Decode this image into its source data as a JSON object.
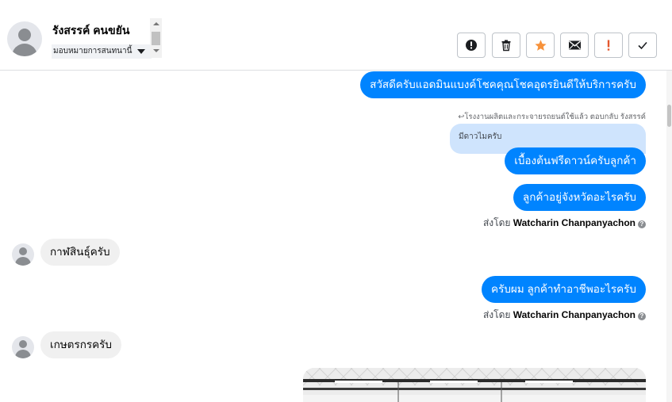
{
  "header": {
    "customer_name": "รังสรรค์ คนขยัน",
    "assign_label": "มอบหมายการสนทนานี้",
    "actions": [
      {
        "name": "report-button",
        "icon": "alert-circle-icon"
      },
      {
        "name": "delete-button",
        "icon": "trash-icon"
      },
      {
        "name": "star-button",
        "icon": "star-icon"
      },
      {
        "name": "mark-unread-button",
        "icon": "envelope-icon"
      },
      {
        "name": "follow-up-button",
        "icon": "exclamation-icon"
      },
      {
        "name": "mark-done-button",
        "icon": "check-icon"
      }
    ]
  },
  "chat": {
    "msg_greeting": "สวัสดีครับแอดมินแบงค์โชคคุณโชคอุดรยินดีให้บริการครับ",
    "reply_note": "โรงงานผลิตและกระจายรถยนต์ใช้แล้ว ตอบกลับ รังสรรค์",
    "quote_text": "มีดาวไมครับ",
    "msg_free_down": "เบื้องต้นฟรีดาวน์ครับลูกค้า",
    "msg_province": "ลูกค้าอยู่จังหวัดอะไรครับ",
    "sent_by_prefix": "ส่งโดย",
    "agent_name": "Watcharin Chanpanyachon",
    "msg_in_1": "กาฬสินธุ์ครับ",
    "msg_occupation": "ครับผม ลูกค้าทำอาชีพอะไรครับ",
    "msg_in_2": "เกษตรกรครับ"
  },
  "colors": {
    "outgoing": "#0084ff",
    "incoming": "#f0f0f0",
    "quote": "#cfe4fd",
    "star": "#f7923b",
    "follow_up": "#e4572e"
  }
}
